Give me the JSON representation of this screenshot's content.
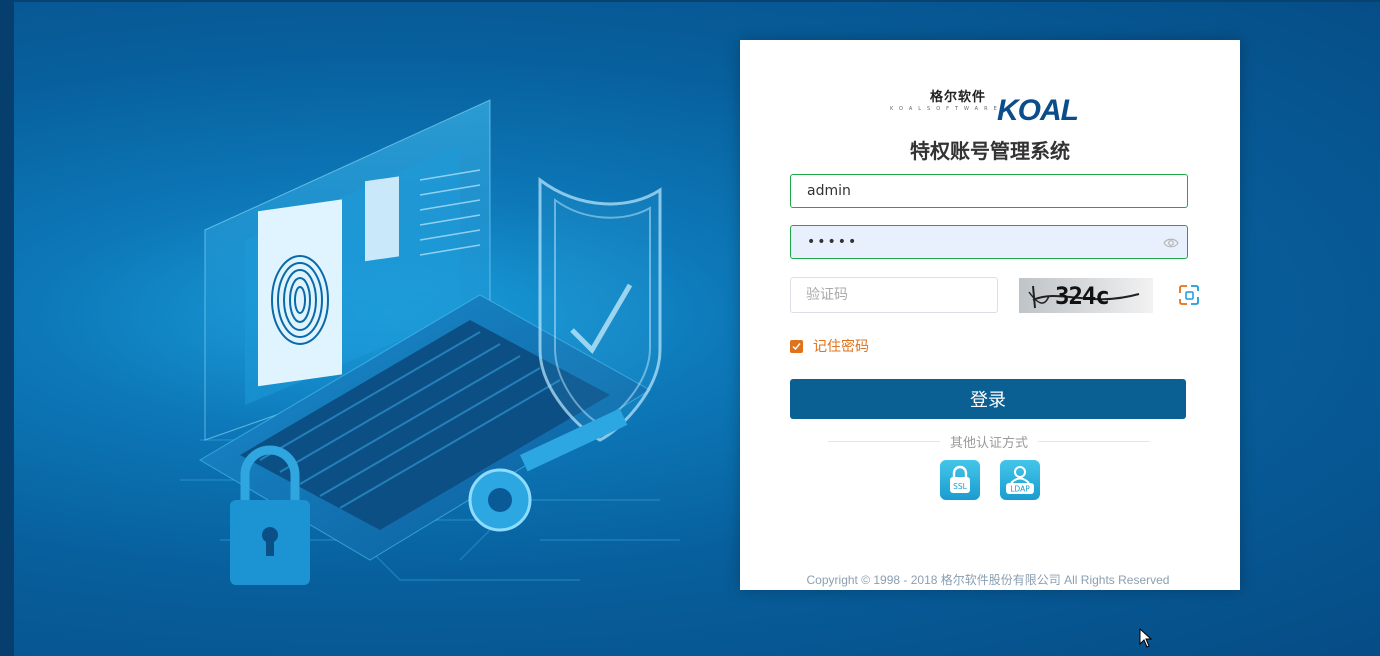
{
  "logo": {
    "cn": "格尔软件",
    "small": "KOALSOFTWARE",
    "brand": "KOAL"
  },
  "login": {
    "title": "特权账号管理系统",
    "username_value": "admin",
    "password_value": "•••••",
    "captcha_placeholder": "验证码",
    "captcha_code": "324c",
    "remember_label": "记住密码",
    "remember_checked": true,
    "login_button": "登录",
    "other_auth_label": "其他认证方式",
    "auth_methods": [
      "SSL",
      "LDAP"
    ]
  },
  "footer": {
    "copyright": "Copyright © 1998 - 2018 格尔软件股份有限公司 All Rights Reserved"
  },
  "colors": {
    "primary": "#0b6093",
    "accent_orange": "#e0721b",
    "input_border": "#1fa84a",
    "auth_icon": "#2bb1de"
  }
}
